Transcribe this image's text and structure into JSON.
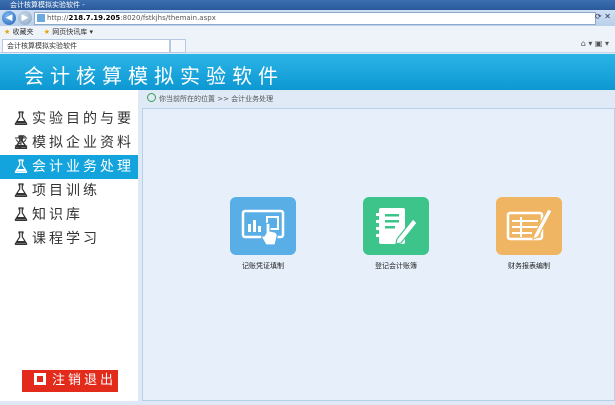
{
  "browser": {
    "window_title": "会计核算模拟实验软件 -",
    "url_prefix": "http://",
    "url_host": "218.7.19.205",
    "url_path": ":8020/fstkjhs/themain.aspx",
    "favorites_label": "收藏夹",
    "web_slice_label": "网页快讯库 ▾",
    "tab_title": "会计核算模拟实验软件"
  },
  "app": {
    "title": "会计核算模拟实验软件"
  },
  "sidebar": {
    "items": [
      {
        "label": "实验目的与要求",
        "active": false
      },
      {
        "label": "模拟企业资料",
        "active": false
      },
      {
        "label": "会计业务处理",
        "active": true
      },
      {
        "label": "项目训练",
        "active": false
      },
      {
        "label": "知识库",
        "active": false
      },
      {
        "label": "课程学习",
        "active": false
      }
    ],
    "logout_label": "注销退出"
  },
  "main": {
    "breadcrumb": "你当前所在的位置 >> 会计业务处理",
    "cards": [
      {
        "label": "记账凭证填制",
        "color": "#5aaee6",
        "icon": "voucher-icon"
      },
      {
        "label": "登记会计账簿",
        "color": "#3cc48a",
        "icon": "ledger-icon"
      },
      {
        "label": "财务报表编制",
        "color": "#f0b562",
        "icon": "report-icon"
      }
    ]
  },
  "colors": {
    "header": "#13a3dd",
    "active_item": "#13a3dd",
    "logout": "#e32b1c"
  }
}
